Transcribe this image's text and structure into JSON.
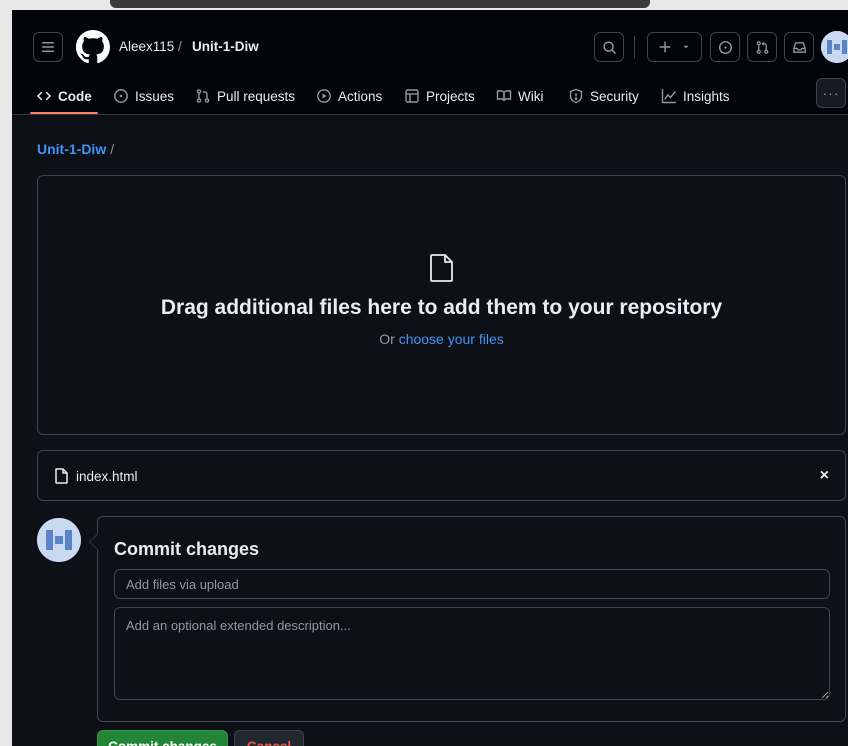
{
  "header": {
    "owner": "Aleex115",
    "separator": "/",
    "repo": "Unit-1-Diw",
    "icons": [
      "hamburger-icon",
      "github-logo-icon",
      "search-icon",
      "plus-icon",
      "chevron-down-icon",
      "issue-icon",
      "pull-request-icon",
      "inbox-icon"
    ]
  },
  "nav": {
    "items": [
      {
        "label": "Code",
        "icon": "code-icon",
        "active": true
      },
      {
        "label": "Issues",
        "icon": "issue-icon"
      },
      {
        "label": "Pull requests",
        "icon": "pull-request-icon"
      },
      {
        "label": "Actions",
        "icon": "play-icon"
      },
      {
        "label": "Projects",
        "icon": "table-icon"
      },
      {
        "label": "Wiki",
        "icon": "book-icon"
      },
      {
        "label": "Security",
        "icon": "shield-icon"
      },
      {
        "label": "Insights",
        "icon": "graph-icon"
      }
    ],
    "more": "···"
  },
  "breadcrumb": {
    "repo": "Unit-1-Diw",
    "slash": "/"
  },
  "dropzone": {
    "title": "Drag additional files here to add them to your repository",
    "sub_prefix": "Or ",
    "sub_link": "choose your files"
  },
  "file": {
    "name": "index.html",
    "close": "×"
  },
  "commit": {
    "title": "Commit changes",
    "summary_placeholder": "Add files via upload",
    "description_placeholder": "Add an optional extended description...",
    "commit_button": "Commit changes",
    "cancel_button": "Cancel"
  },
  "colors": {
    "background": "#0d1117",
    "header": "#010409",
    "border": "#3d444d",
    "link": "#4493f8",
    "active_underline": "#f78166",
    "commit_green": "#238636",
    "cancel_red": "#f85149"
  }
}
